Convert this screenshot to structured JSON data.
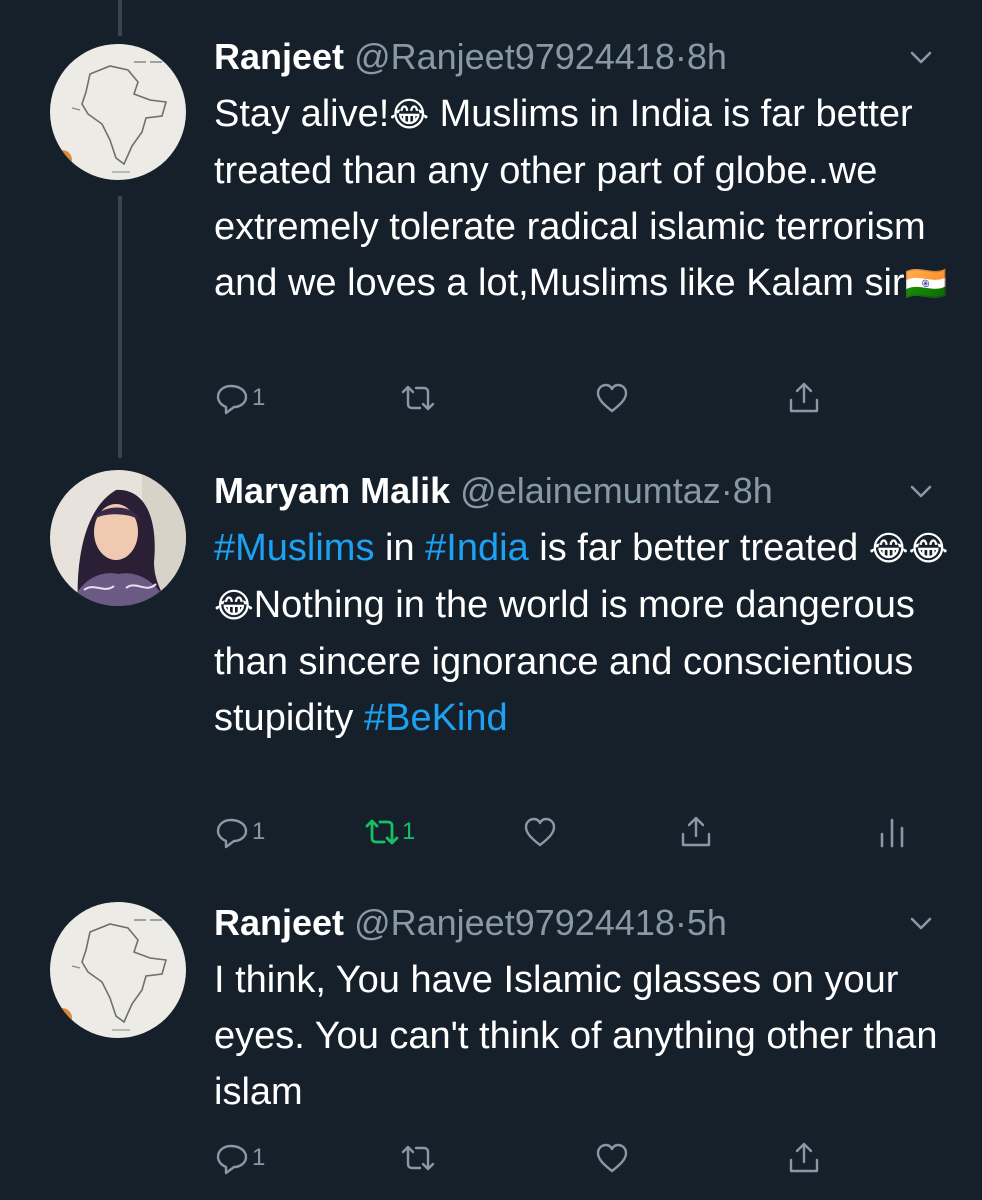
{
  "tweets": [
    {
      "name": "Ranjeet",
      "handle": "@Ranjeet97924418",
      "separator": "·",
      "time": "8h",
      "avatar": "india-map-avatar",
      "body": {
        "t1": "Stay alive!",
        "e1": "😂",
        "t2": " Muslims in India is far better treated than any other part of globe..we extremely tolerate radical islamic terrorism and we loves a lot,Muslims like Kalam sir",
        "e2": "🇮🇳"
      },
      "replies": "1",
      "retweets": "",
      "likes": ""
    },
    {
      "name": "Maryam Malik",
      "handle": "@elainemumtaz",
      "separator": "·",
      "time": "8h",
      "avatar": "woman-hijab-avatar",
      "body": {
        "h1": "#Muslims",
        "t1": " in ",
        "h2": "#India",
        "t2": " is far better treated ",
        "emojis": "😂😂😂",
        "t3": "Nothing in the world is more dangerous than sincere ignorance and conscientious stupidity ",
        "h3": "#BeKind"
      },
      "replies": "1",
      "retweets": "1",
      "likes": ""
    },
    {
      "name": "Ranjeet",
      "handle": "@Ranjeet97924418",
      "separator": "·",
      "time": "5h",
      "avatar": "india-map-avatar",
      "body": {
        "t1": "I think, You have Islamic glasses on your eyes. You can't think of anything other than islam"
      },
      "replies": "1",
      "retweets": "",
      "likes": ""
    }
  ],
  "icons": {
    "reply": "speech-bubble-icon",
    "retweet": "retweet-arrows-icon",
    "like": "heart-icon",
    "share": "share-arrow-icon",
    "analytics": "bar-chart-icon",
    "more": "chevron-down-icon"
  },
  "colors": {
    "background": "#15202b",
    "text": "#ffffff",
    "secondary": "#8899a6",
    "hashtag": "#1da1f2",
    "retweeted": "#17bf63",
    "thread_line": "#38444d"
  }
}
